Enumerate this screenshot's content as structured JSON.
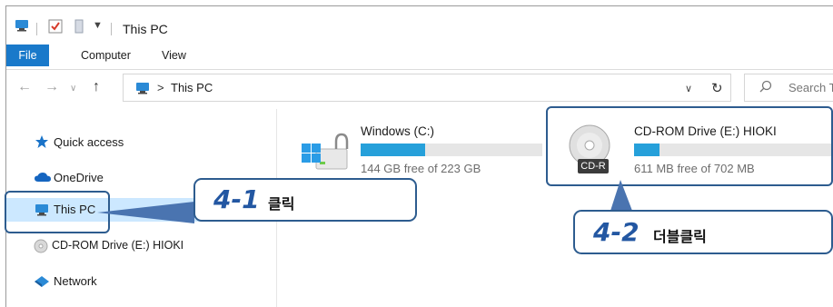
{
  "window": {
    "title": "This PC",
    "quick_access_icons": [
      "this-pc-icon",
      "properties-check-icon",
      "new-folder-icon",
      "customize-dropdown-icon"
    ]
  },
  "ribbon": {
    "tabs": [
      {
        "label": "File",
        "active": true
      },
      {
        "label": "Computer"
      },
      {
        "label": "View"
      }
    ]
  },
  "address_bar": {
    "separator": ">",
    "location": "This PC",
    "search_placeholder": "Search T"
  },
  "nav_pane": {
    "items": [
      {
        "label": "Quick access",
        "icon": "star-icon"
      },
      {
        "label": "OneDrive",
        "icon": "cloud-icon"
      },
      {
        "label": "This PC",
        "icon": "this-pc-icon",
        "selected": true
      },
      {
        "label": "CD-ROM Drive (E:) HIOKI",
        "icon": "cd-icon"
      },
      {
        "label": "Network",
        "icon": "network-icon"
      }
    ]
  },
  "drives": [
    {
      "name": "Windows (C:)",
      "free_text": "144 GB free of 223 GB",
      "used_fraction": 0.354,
      "icon": "windows-drive-icon"
    },
    {
      "name": "CD-ROM Drive (E:) HIOKI",
      "free_text": "611 MB free of 702 MB",
      "used_fraction": 0.13,
      "icon": "cd-r-icon",
      "icon_label": "CD-R"
    }
  ],
  "callouts": [
    {
      "number": "4-1",
      "text": "클릭"
    },
    {
      "number": "4-2",
      "text": "더블클릭"
    }
  ],
  "colors": {
    "accent": "#1979ca",
    "selection": "#cce8ff",
    "bar_fill": "#26a0da",
    "callout_border": "#2d5c8f",
    "callout_number": "#2357a2"
  }
}
